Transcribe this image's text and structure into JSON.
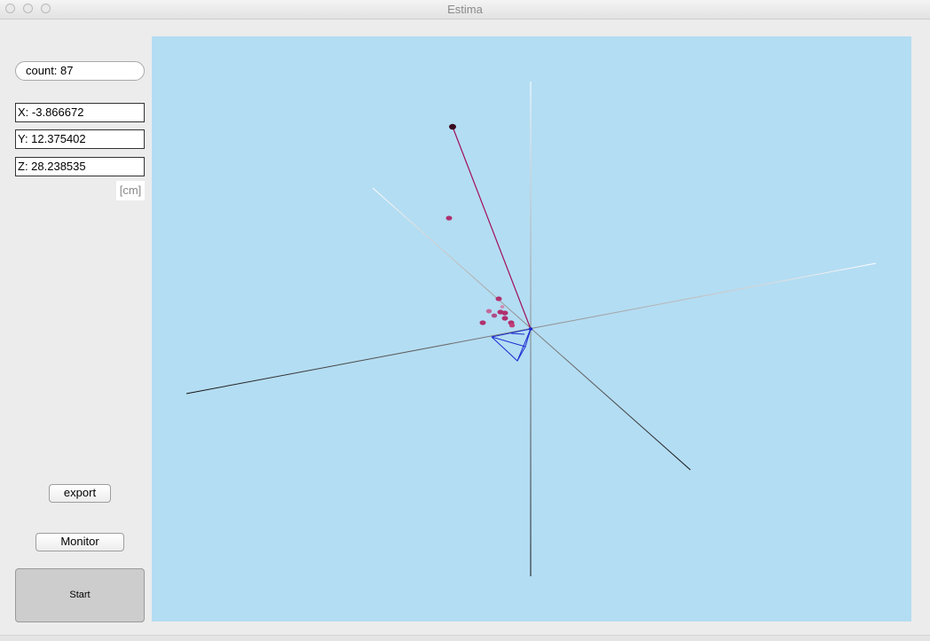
{
  "window": {
    "title": "Estima"
  },
  "panel": {
    "count_label": "count: 87",
    "x_label": "X: -3.866672",
    "y_label": "Y: 12.375402",
    "z_label": "Z: 28.238535",
    "unit": "[cm]",
    "export_label": "export",
    "monitor_label": "Monitor",
    "start_label": "Start"
  },
  "colors": {
    "viewport_background": "#b3ddf3",
    "track_line": "#a0105a",
    "marker_blue": "#1a2ad0"
  }
}
